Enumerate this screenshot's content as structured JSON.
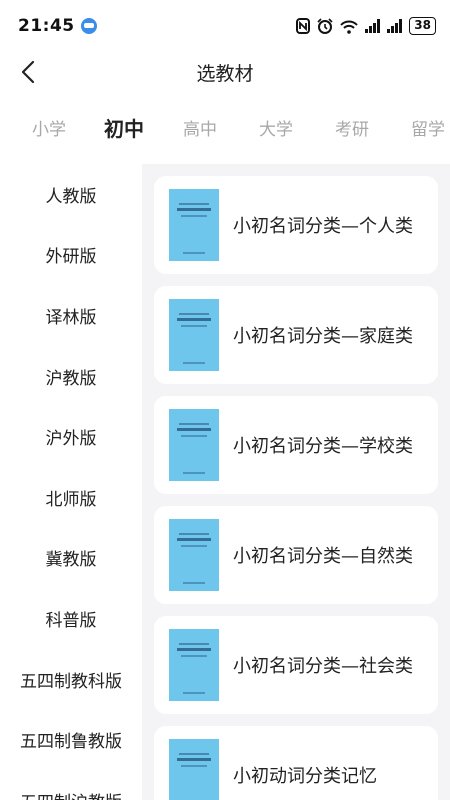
{
  "status": {
    "time": "21:45",
    "battery": "38"
  },
  "header": {
    "title": "选教材"
  },
  "tabs": [
    {
      "label": "小学",
      "active": false
    },
    {
      "label": "初中",
      "active": true
    },
    {
      "label": "高中",
      "active": false
    },
    {
      "label": "大学",
      "active": false
    },
    {
      "label": "考研",
      "active": false
    },
    {
      "label": "留学",
      "active": false
    }
  ],
  "sidebar": {
    "items": [
      {
        "label": "人教版"
      },
      {
        "label": "外研版"
      },
      {
        "label": "译林版"
      },
      {
        "label": "沪教版"
      },
      {
        "label": "沪外版"
      },
      {
        "label": "北师版"
      },
      {
        "label": "冀教版"
      },
      {
        "label": "科普版"
      },
      {
        "label": "五四制教科版"
      },
      {
        "label": "五四制鲁教版"
      },
      {
        "label": "五四制沪教版"
      }
    ]
  },
  "books": [
    {
      "title": "小初名词分类—个人类"
    },
    {
      "title": "小初名词分类—家庭类"
    },
    {
      "title": "小初名词分类—学校类"
    },
    {
      "title": "小初名词分类—自然类"
    },
    {
      "title": "小初名词分类—社会类"
    },
    {
      "title": "小初动词分类记忆"
    }
  ]
}
